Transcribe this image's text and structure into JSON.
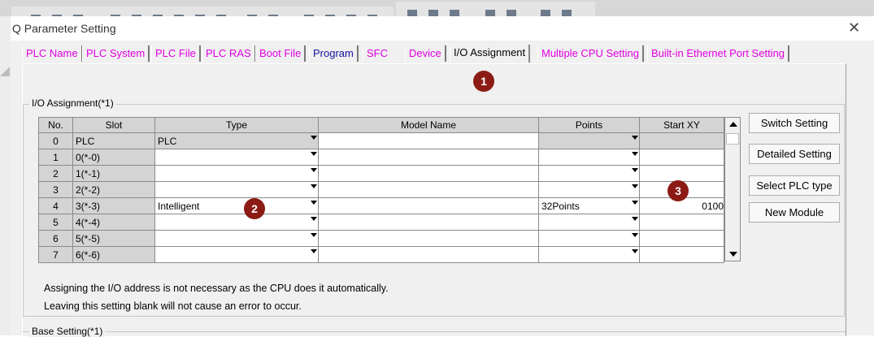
{
  "window": {
    "title": "Q Parameter Setting",
    "close_glyph": "✕"
  },
  "tabs": [
    {
      "label": "PLC Name",
      "color": "#e000e0"
    },
    {
      "label": "PLC System",
      "color": "#e000e0"
    },
    {
      "label": "PLC File",
      "color": "#e000e0"
    },
    {
      "label": "PLC RAS",
      "color": "#e000e0"
    },
    {
      "label": "Boot File",
      "color": "#e000e0"
    },
    {
      "label": "Program",
      "color": "#1414a0"
    },
    {
      "label": "SFC",
      "color": "#e000e0"
    },
    {
      "label": "Device",
      "color": "#e000e0"
    },
    {
      "label": "I/O Assignment",
      "color": "#000000",
      "active": true
    },
    {
      "label": "Multiple CPU Setting",
      "color": "#e000e0"
    },
    {
      "label": "Built-in Ethernet Port Setting",
      "color": "#e000e0"
    }
  ],
  "io_assignment": {
    "group_label": "I/O Assignment(*1)",
    "columns": [
      "No.",
      "Slot",
      "Type",
      "Model Name",
      "Points",
      "Start XY"
    ],
    "rows": [
      {
        "no": "0",
        "slot": "PLC",
        "type": "PLC",
        "model": "",
        "points": "",
        "start": ""
      },
      {
        "no": "1",
        "slot": "0(*-0)",
        "type": "",
        "model": "",
        "points": "",
        "start": ""
      },
      {
        "no": "2",
        "slot": "1(*-1)",
        "type": "",
        "model": "",
        "points": "",
        "start": ""
      },
      {
        "no": "3",
        "slot": "2(*-2)",
        "type": "",
        "model": "",
        "points": "",
        "start": ""
      },
      {
        "no": "4",
        "slot": "3(*-3)",
        "type": "Intelligent",
        "model": "",
        "points": "32Points",
        "start": "0100"
      },
      {
        "no": "5",
        "slot": "4(*-4)",
        "type": "",
        "model": "",
        "points": "",
        "start": ""
      },
      {
        "no": "6",
        "slot": "5(*-5)",
        "type": "",
        "model": "",
        "points": "",
        "start": ""
      },
      {
        "no": "7",
        "slot": "6(*-6)",
        "type": "",
        "model": "",
        "points": "",
        "start": ""
      }
    ],
    "buttons": {
      "switch": "Switch Setting",
      "detailed": "Detailed Setting",
      "select_plc": "Select PLC type",
      "new_module": "New Module"
    },
    "notes": [
      "Assigning the I/O address is not necessary as the CPU does it automatically.",
      "Leaving this setting blank will not cause an error to occur."
    ]
  },
  "base_setting": {
    "label": "Base Setting(*1)"
  },
  "callouts": [
    "1",
    "2",
    "3"
  ],
  "colors": {
    "badge": "#8b1b14",
    "tab_magenta": "#e000e0",
    "tab_blue": "#1414a0",
    "grid_gray": "#d4d4d4"
  }
}
